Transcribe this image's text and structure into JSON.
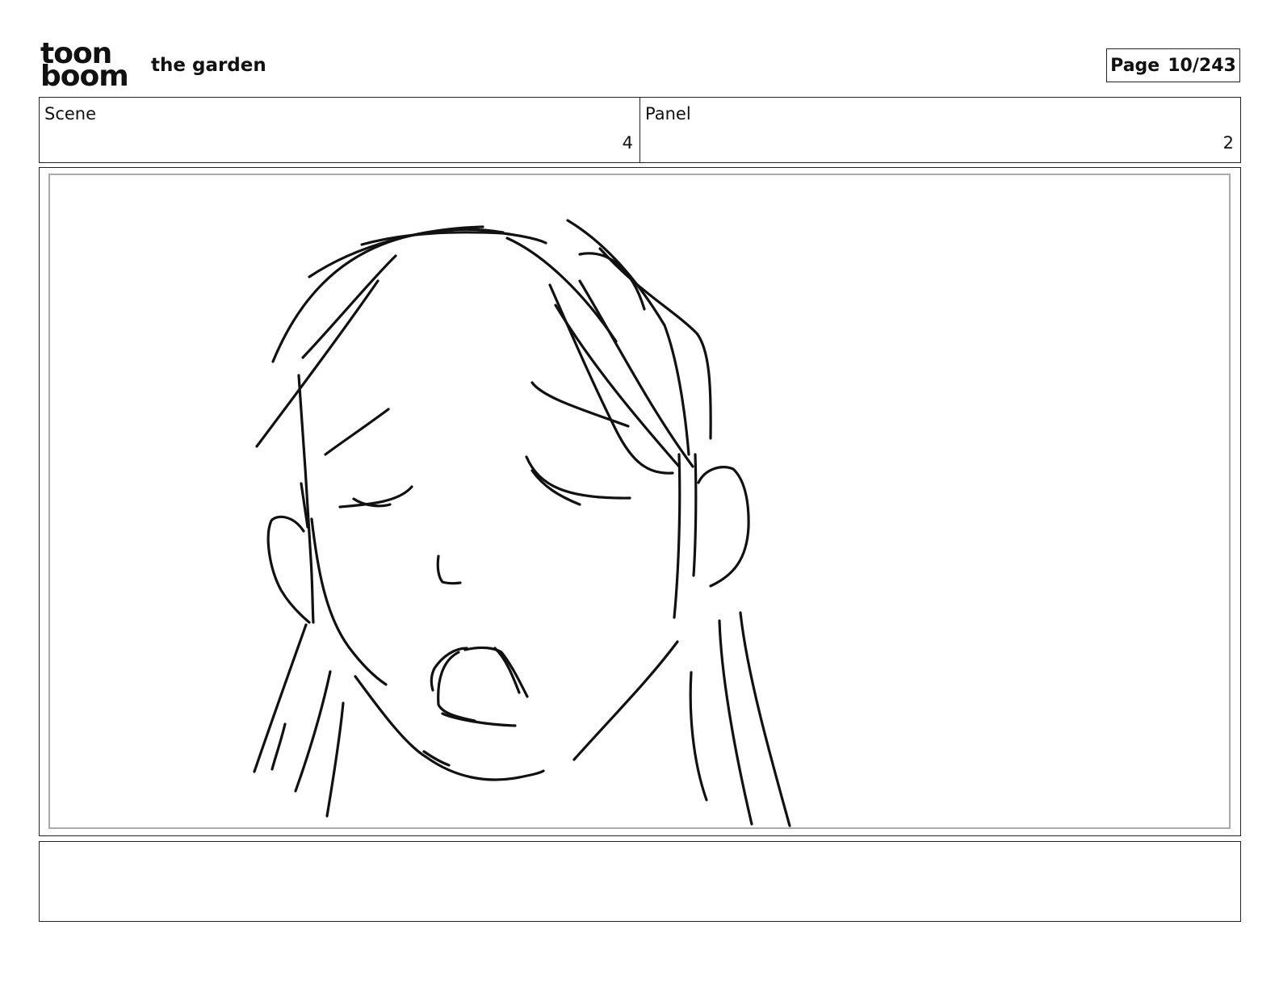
{
  "header": {
    "logo_line1": "toon",
    "logo_line2": "boom",
    "project_title": "the garden",
    "page_label": "Page",
    "page_number": "10/243"
  },
  "info": {
    "scene_label": "Scene",
    "scene_value": "4",
    "panel_label": "Panel",
    "panel_value": "2"
  },
  "panel": {
    "image": "sketch-of-face-with-closed-eyes-and-open-mouth"
  },
  "notes": {
    "text": ""
  }
}
